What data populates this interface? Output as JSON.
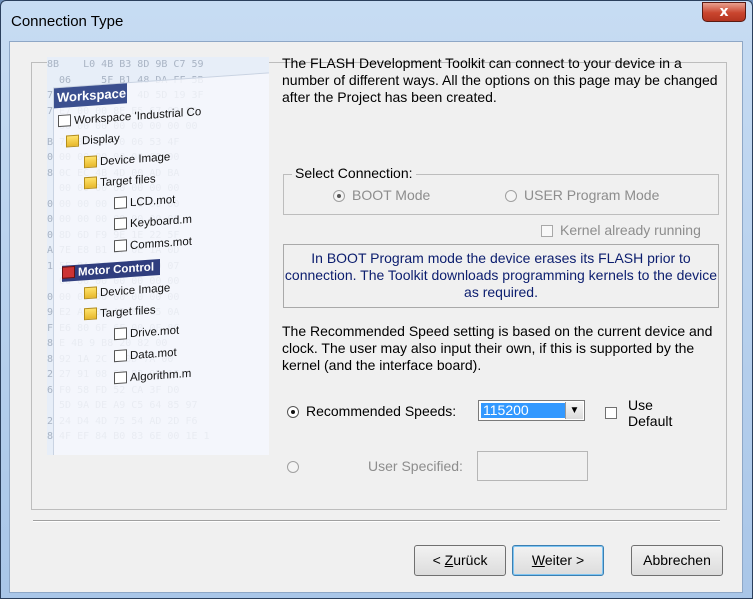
{
  "window": {
    "title": "Connection Type",
    "close_glyph": "x"
  },
  "illustration": {
    "header": "Workspace",
    "hex_lines": [
      "8B    L0 4B B3 8D 9B C7 59",
      "  06     5F B1 48 DA FF 5B",
      "7 2A 9A 2C     4D 5D 19 3F",
      "7 E7 00 00 8E E5 67 09 8D",
      "  00 00 00 00 00 00 00 00",
      "B 7F 32 EA 70 06 53 4F",
      "0 00 00 00 00 00 00 00",
      "8 0C EC 4B 4D 00 AD BA",
      "  00 00 00 00 00 00 00",
      "0 00 00 00 00 00 00 00",
      "0 00 00 00 00 00 00 00",
      "0 8D 6D F9 9E 1E 22 5F",
      "A 7E E8 B1 17 0E 1A 0D",
      "1 5E 8A 33 1E 0C 00 07",
      "  00 00 00 00 00 00 00",
      "0 00 00 00 00 00 00 00",
      "9 E2 AC 00 A2 E3 C5 0A",
      "F E6 80 6F 6F 00 0F 8C",
      "8 E 4B 9 B8 20 82 00",
      "8 92 1A 2C 8 0D 7A 00",
      "2 27 91 08 52 B2 9B 1F",
      "6 F0 58 FD 52 CA 3F D0",
      "  5D 9A DE A9 C5 64 85 97",
      "2 24 D4 4D 75 54 AD 2D F6",
      "8 4F EF 84 B0 83 6E 00 1E 1"
    ],
    "tree": [
      {
        "label": "Workspace 'Industrial Co",
        "icon": "workspace-icon"
      },
      {
        "label": "Display",
        "icon": "folder-icon"
      },
      {
        "label": "Device Image",
        "icon": "folder-icon"
      },
      {
        "label": "Target files",
        "icon": "folder-icon"
      },
      {
        "label": "LCD.mot",
        "icon": "file-icon"
      },
      {
        "label": "Keyboard.m",
        "icon": "file-icon"
      },
      {
        "label": "Comms.mot",
        "icon": "file-icon"
      },
      {
        "label": "Motor Control",
        "icon": "project-icon"
      },
      {
        "label": "Device Image",
        "icon": "folder-icon"
      },
      {
        "label": "Target files",
        "icon": "folder-icon"
      },
      {
        "label": "Drive.mot",
        "icon": "file-icon"
      },
      {
        "label": "Data.mot",
        "icon": "file-icon"
      },
      {
        "label": "Algorithm.m",
        "icon": "file-icon"
      }
    ]
  },
  "intro_text": "The FLASH Development Toolkit can connect to your device in a number of different ways. All the options on this page may be changed after the Project has been created.",
  "select_connection": {
    "label": "Select Connection:",
    "boot_mode": "BOOT Mode",
    "user_mode": "USER Program Mode",
    "selected": "boot"
  },
  "kernel_checkbox": {
    "label": "Kernel already running",
    "checked": false
  },
  "info_box_text": "In BOOT Program mode the device erases its FLASH prior to connection. The Toolkit downloads programming kernels to the device as required.",
  "speed_text": "The Recommended Speed setting is based on the current device and clock. The user may also input their own, if this is supported by the kernel (and the interface board).",
  "recommended_speeds": {
    "label": "Recommended Speeds:",
    "value": "115200",
    "selected": true
  },
  "use_default": {
    "label_line1": "Use",
    "label_line2": "Default",
    "checked": false
  },
  "user_specified": {
    "label": "User Specified:",
    "value": "",
    "selected": false
  },
  "buttons": {
    "back": {
      "mnemonic": "Z",
      "rest": "urück",
      "prefix": "< "
    },
    "next": {
      "mnemonic": "W",
      "rest": "eiter >"
    },
    "cancel": "Abbrechen"
  }
}
